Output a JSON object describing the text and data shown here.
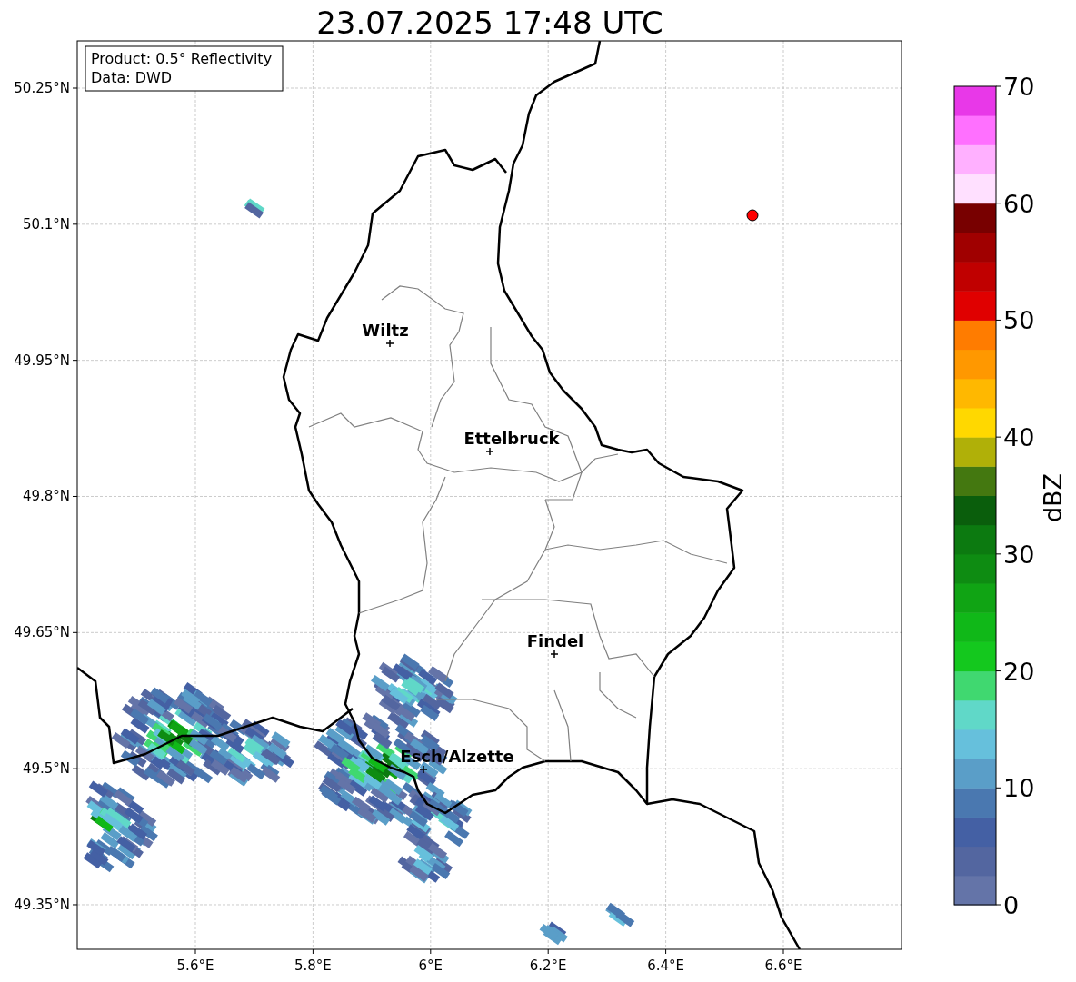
{
  "title": "23.07.2025 17:48 UTC",
  "info_box": {
    "lines": [
      "Product: 0.5° Reflectivity",
      "Data: DWD"
    ]
  },
  "map": {
    "lat_ticks": [
      "50.25°N",
      "50.1°N",
      "49.95°N",
      "49.8°N",
      "49.65°N",
      "49.5°N",
      "49.35°N"
    ],
    "lon_ticks": [
      "5.6°E",
      "5.8°E",
      "6°E",
      "6.2°E",
      "6.4°E",
      "6.6°E"
    ],
    "cities": [
      {
        "name": "Wiltz"
      },
      {
        "name": "Ettelbruck"
      },
      {
        "name": "Findel"
      },
      {
        "name": "Esch/Alzette"
      }
    ],
    "marker": {
      "color": "#ff0000"
    }
  },
  "colorbar": {
    "label": "dBZ",
    "ticks": [
      "70",
      "60",
      "50",
      "40",
      "30",
      "20",
      "10",
      "0"
    ],
    "bins": [
      {
        "color": "#6474a8"
      },
      {
        "color": "#5366a0"
      },
      {
        "color": "#4460a4"
      },
      {
        "color": "#4a78b0"
      },
      {
        "color": "#5a9ec8"
      },
      {
        "color": "#66c0dc"
      },
      {
        "color": "#60d8c8"
      },
      {
        "color": "#40d870"
      },
      {
        "color": "#14c81e"
      },
      {
        "color": "#10b818"
      },
      {
        "color": "#10a414"
      },
      {
        "color": "#0e8c12"
      },
      {
        "color": "#0c7a10"
      },
      {
        "color": "#0a5e0c"
      },
      {
        "color": "#447810"
      },
      {
        "color": "#b0b008"
      },
      {
        "color": "#ffd800"
      },
      {
        "color": "#ffb800"
      },
      {
        "color": "#ff9800"
      },
      {
        "color": "#ff7c00"
      },
      {
        "color": "#e00000"
      },
      {
        "color": "#c00000"
      },
      {
        "color": "#a00000"
      },
      {
        "color": "#780000"
      },
      {
        "color": "#ffe0ff"
      },
      {
        "color": "#ffb0ff"
      },
      {
        "color": "#ff70ff"
      },
      {
        "color": "#e838e8"
      }
    ]
  }
}
